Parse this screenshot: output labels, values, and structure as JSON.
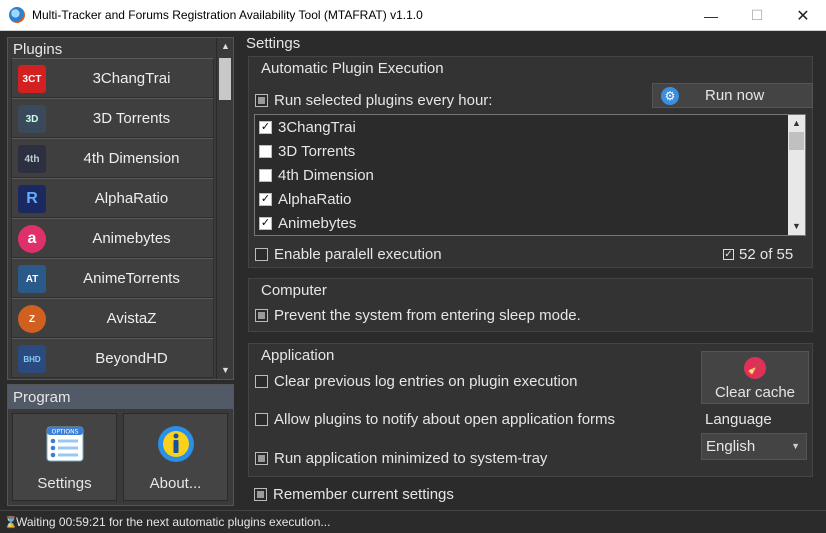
{
  "window": {
    "title": "Multi-Tracker and Forums Registration Availability Tool (MTAFRAT) v1.1.0",
    "minimize": "—",
    "maximize": "☐",
    "close": "✕"
  },
  "plugins_panel": {
    "title": "Plugins",
    "items": [
      {
        "label": "3ChangTrai",
        "icon": "3ct-logo-icon",
        "icon_text": "3CT",
        "color": "#d32020"
      },
      {
        "label": "3D Torrents",
        "icon": "3d-logo-icon",
        "icon_text": "3D",
        "color": "#3a4a5a"
      },
      {
        "label": "4th Dimension",
        "icon": "4th-logo-icon",
        "icon_text": "4th",
        "color": "#2c3040"
      },
      {
        "label": "AlphaRatio",
        "icon": "alpharatio-logo-icon",
        "icon_text": "R",
        "color": "#1a2a60"
      },
      {
        "label": "Animebytes",
        "icon": "animebytes-logo-icon",
        "icon_text": "a",
        "color": "#e0306a"
      },
      {
        "label": "AnimeTorrents",
        "icon": "animetorrents-logo-icon",
        "icon_text": "AT",
        "color": "#2a5a8a"
      },
      {
        "label": "AvistaZ",
        "icon": "avistaz-logo-icon",
        "icon_text": "Z",
        "color": "#d06020"
      },
      {
        "label": "BeyondHD",
        "icon": "beyondhd-logo-icon",
        "icon_text": "BHD",
        "color": "#2a4a80"
      }
    ]
  },
  "program_panel": {
    "title": "Program",
    "settings_label": "Settings",
    "about_label": "About...",
    "options_text": "OPTIONS"
  },
  "settings": {
    "title": "Settings",
    "auto_exec": {
      "title": "Automatic Plugin Execution",
      "run_hourly_label": "Run selected plugins every hour:",
      "run_now_label": "Run now",
      "plugin_checks": [
        {
          "label": "3ChangTrai",
          "checked": true
        },
        {
          "label": "3D Torrents",
          "checked": false
        },
        {
          "label": "4th Dimension",
          "checked": false
        },
        {
          "label": "AlphaRatio",
          "checked": true
        },
        {
          "label": "Animebytes",
          "checked": true
        }
      ],
      "parallel_label": "Enable paralell execution",
      "count_text": "52 of 55"
    },
    "computer": {
      "title": "Computer",
      "sleep_label": "Prevent the system from entering sleep mode."
    },
    "application": {
      "title": "Application",
      "clear_log_label": "Clear previous log entries on plugin execution",
      "notify_label": "Allow plugins to notify about open application forms",
      "minimized_label": "Run application minimized to system-tray",
      "clear_cache_label": "Clear cache",
      "language_label": "Language",
      "language_value": "English"
    },
    "remember_label": "Remember current settings"
  },
  "status": {
    "text": "Waiting 00:59:21 for the next automatic plugins execution..."
  }
}
